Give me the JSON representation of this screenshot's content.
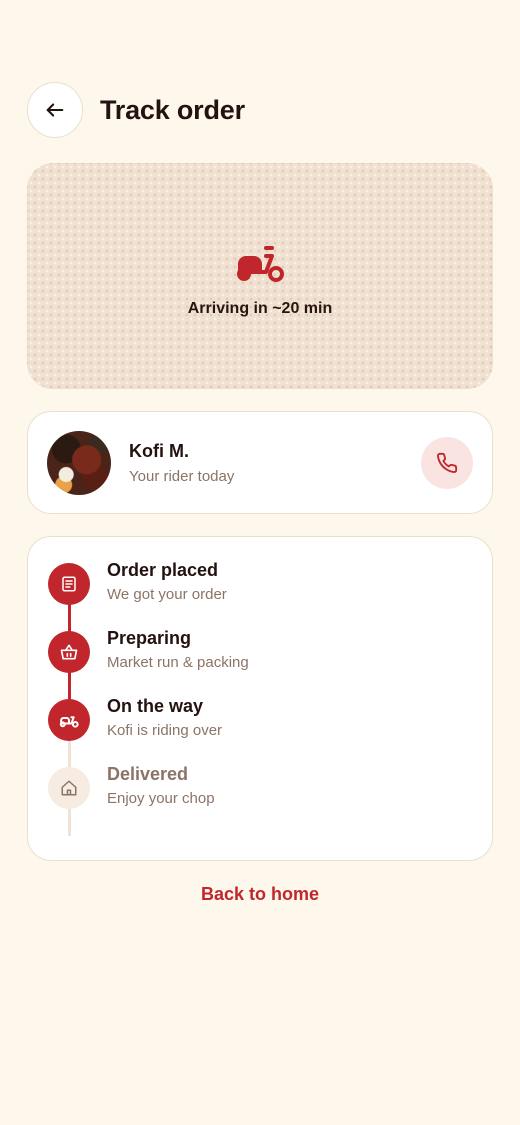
{
  "header": {
    "title": "Track order",
    "back_icon": "arrow-left-icon"
  },
  "map": {
    "icon": "scooter-icon",
    "arrival_text": "Arriving in ~20 min"
  },
  "rider": {
    "name": "Kofi M.",
    "subtitle": "Your rider today",
    "call_icon": "phone-icon"
  },
  "timeline": {
    "steps": [
      {
        "title": "Order placed",
        "subtitle": "We got your order",
        "status": "done",
        "icon": "receipt-icon"
      },
      {
        "title": "Preparing",
        "subtitle": "Market run & packing",
        "status": "done",
        "icon": "basket-icon"
      },
      {
        "title": "On the way",
        "subtitle": "Kofi is riding over",
        "status": "active",
        "icon": "scooter-icon"
      },
      {
        "title": "Delivered",
        "subtitle": "Enjoy your chop",
        "status": "pending",
        "icon": "home-icon"
      }
    ]
  },
  "footer": {
    "back_home_label": "Back to home"
  },
  "colors": {
    "accent": "#c0262b",
    "background": "#fdf7ec",
    "muted_text": "#8b7466",
    "pending_dot": "#f6ece1",
    "call_button_bg": "#fae4e1"
  }
}
